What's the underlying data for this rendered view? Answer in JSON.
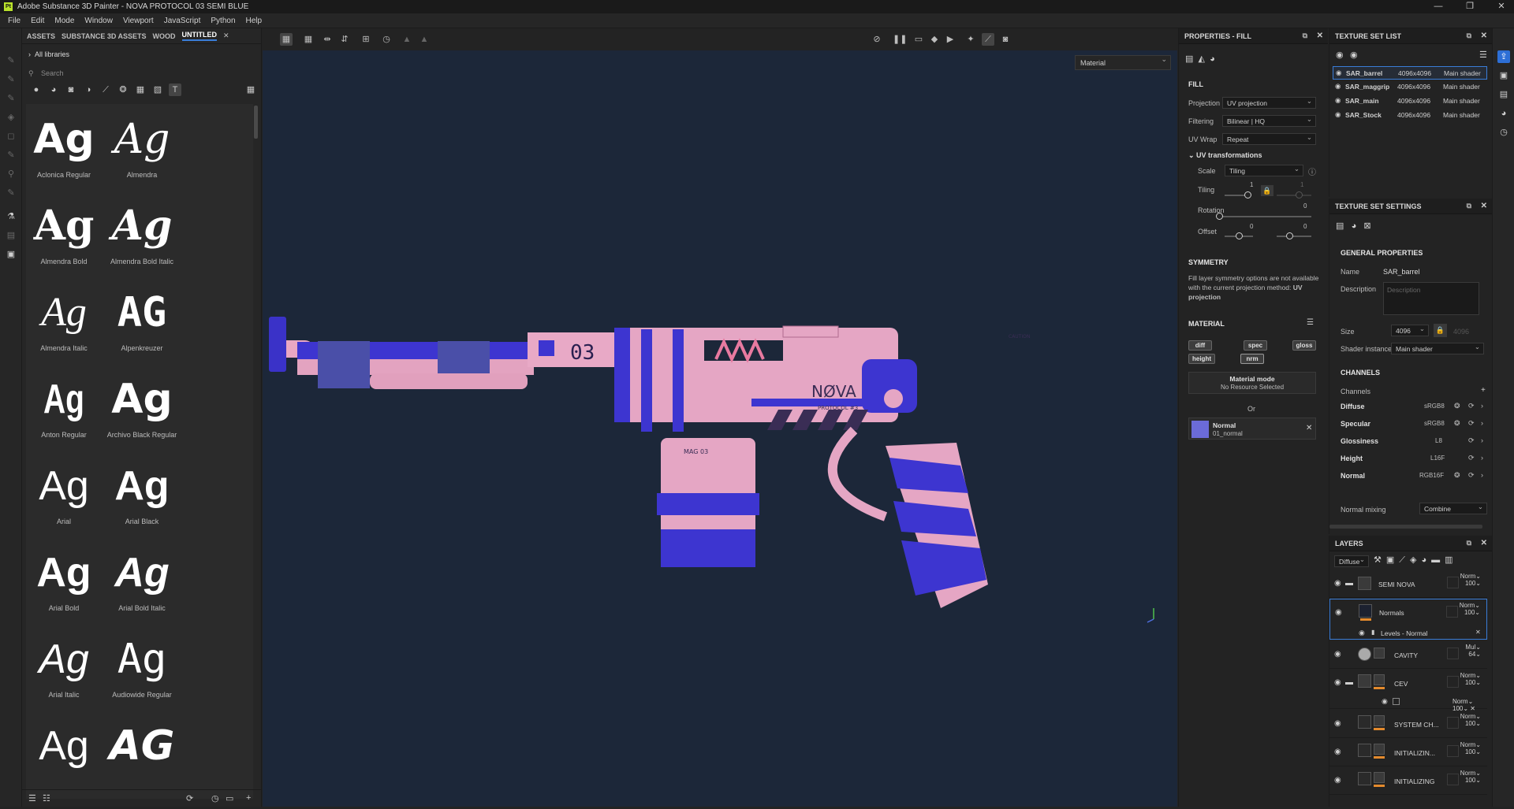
{
  "titlebar": {
    "title": "Adobe Substance 3D Painter - NOVA PROTOCOL 03 SEMI BLUE",
    "logo": "Pt"
  },
  "menu": [
    "File",
    "Edit",
    "Mode",
    "Window",
    "Viewport",
    "JavaScript",
    "Python",
    "Help"
  ],
  "assets": {
    "tabs": [
      "ASSETS",
      "SUBSTANCE 3D ASSETS",
      "WOOD",
      "UNTITLED"
    ],
    "library": "All libraries",
    "search_placeholder": "Search",
    "fonts": [
      {
        "glyph": "Ag",
        "name": "Aclonica Regular"
      },
      {
        "glyph": "Ag",
        "name": "Almendra"
      },
      {
        "glyph": "Ag",
        "name": "Almendra Bold"
      },
      {
        "glyph": "Ag",
        "name": "Almendra Bold Italic"
      },
      {
        "glyph": "Ag",
        "name": "Almendra Italic"
      },
      {
        "glyph": "AG",
        "name": "Alpenkreuzer"
      },
      {
        "glyph": "Ag",
        "name": "Anton Regular"
      },
      {
        "glyph": "Ag",
        "name": "Archivo Black Regular"
      },
      {
        "glyph": "Ag",
        "name": "Arial"
      },
      {
        "glyph": "Ag",
        "name": "Arial Black"
      },
      {
        "glyph": "Ag",
        "name": "Arial Bold"
      },
      {
        "glyph": "Ag",
        "name": "Arial Bold Italic"
      },
      {
        "glyph": "Ag",
        "name": "Arial Italic"
      },
      {
        "glyph": "Ag",
        "name": "Audiowide Regular"
      },
      {
        "glyph": "Ag",
        "name": ""
      },
      {
        "glyph": "AG",
        "name": ""
      }
    ]
  },
  "viewport": {
    "material_mode": "Material",
    "gun_brand": "NØVA",
    "gun_sub": "PROTOCOL #3",
    "gun_num": "03",
    "gun_mag": "MAG 03",
    "gun_caution": "CAUTION"
  },
  "properties": {
    "header": "PROPERTIES - FILL",
    "fill_title": "FILL",
    "projection_label": "Projection",
    "projection_value": "UV projection",
    "filtering_label": "Filtering",
    "filtering_value": "Bilinear | HQ",
    "uvwrap_label": "UV Wrap",
    "uvwrap_value": "Repeat",
    "uvtrans_label": "UV transformations",
    "scale_label": "Scale",
    "scale_value": "Tiling",
    "tiling_label": "Tiling",
    "tiling_v1": "1",
    "tiling_v2": "1",
    "rotation_label": "Rotation",
    "rotation_v": "0",
    "offset_label": "Offset",
    "offset_v1": "0",
    "offset_v2": "0",
    "symmetry_title": "SYMMETRY",
    "symmetry_text": "Fill layer symmetry options are not available with the current projection method:",
    "symmetry_bold": "UV projection",
    "material_title": "MATERIAL",
    "chips": [
      "diff",
      "spec",
      "gloss",
      "height",
      "nrm"
    ],
    "material_mode_title": "Material mode",
    "material_mode_value": "No Resource Selected",
    "or_text": "Or",
    "normal_name": "Normal",
    "normal_file": "01_normal",
    "normal_color": "#6b6bd8"
  },
  "texture_set_list": {
    "header": "TEXTURE SET LIST",
    "rows": [
      {
        "name": "SAR_barrel",
        "size": "4096x4096",
        "shader": "Main shader"
      },
      {
        "name": "SAR_maggrip",
        "size": "4096x4096",
        "shader": "Main shader"
      },
      {
        "name": "SAR_main",
        "size": "4096x4096",
        "shader": "Main shader"
      },
      {
        "name": "SAR_Stock",
        "size": "4096x4096",
        "shader": "Main shader"
      }
    ]
  },
  "texture_set_settings": {
    "header": "TEXTURE SET SETTINGS",
    "general": "GENERAL PROPERTIES",
    "name_label": "Name",
    "name_value": "SAR_barrel",
    "desc_label": "Description",
    "desc_placeholder": "Description",
    "size_label": "Size",
    "size_value": "4096",
    "size_value2": "4096",
    "shader_label": "Shader instance",
    "shader_value": "Main shader",
    "channels_title": "CHANNELS",
    "channels_label": "Channels",
    "channels": [
      {
        "name": "Diffuse",
        "fmt": "sRGB8"
      },
      {
        "name": "Specular",
        "fmt": "sRGB8"
      },
      {
        "name": "Glossiness",
        "fmt": "L8"
      },
      {
        "name": "Height",
        "fmt": "L16F"
      },
      {
        "name": "Normal",
        "fmt": "RGB16F"
      }
    ],
    "mixing_label": "Normal mixing",
    "mixing_value": "Combine"
  },
  "layers": {
    "header": "LAYERS",
    "channel": "Diffuse",
    "rows": [
      {
        "name": "SEMI NOVA",
        "blend": "Norm",
        "op": "100"
      },
      {
        "name": "Normals",
        "blend": "Norm",
        "op": "100"
      },
      {
        "name": "Levels - Normal",
        "blend": "",
        "op": ""
      },
      {
        "name": "CAVITY",
        "blend": "Mul",
        "op": "64"
      },
      {
        "name": "CEV",
        "blend": "Norm",
        "op": "100"
      },
      {
        "name": "",
        "blend": "Norm",
        "op": "100"
      },
      {
        "name": "SYSTEM CH...",
        "blend": "Norm",
        "op": "100"
      },
      {
        "name": "INITIALIZIN...",
        "blend": "Norm",
        "op": "100"
      },
      {
        "name": "INITIALIZING",
        "blend": "Norm",
        "op": "100"
      }
    ]
  }
}
